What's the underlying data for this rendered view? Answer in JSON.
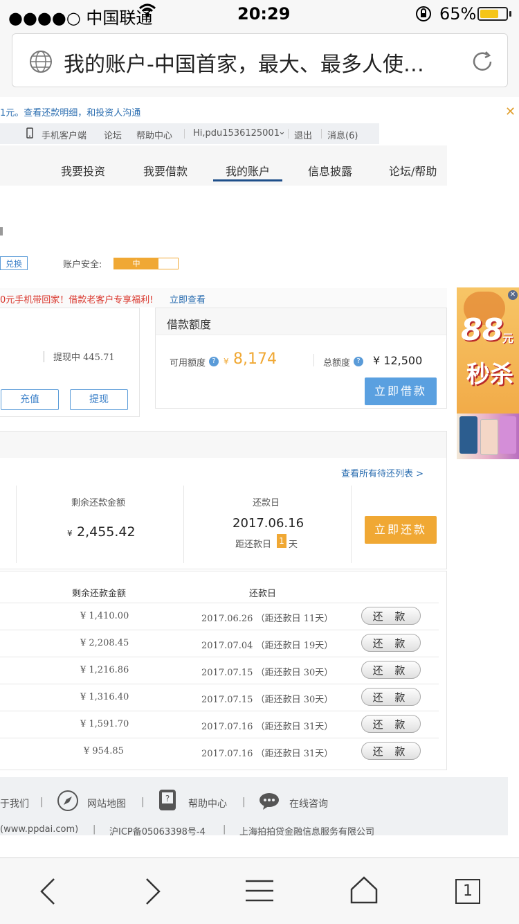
{
  "status_bar": {
    "carrier": "●●●●○ 中国联通",
    "time": "20:29",
    "battery": "65%"
  },
  "browser": {
    "url_title": "我的账户-中国首家，最大、最多人使…"
  },
  "tip": {
    "prefix": "1元。",
    "link": "查看还款明细，和投资人沟通"
  },
  "top_nav": {
    "mobile": "手机客户端",
    "forum": "论坛",
    "help": "帮助中心",
    "user": "Hi,pdu1536125001",
    "logout": "退出",
    "messages": "消息(6)"
  },
  "main_nav": {
    "invest": "我要投资",
    "borrow": "我要借款",
    "account": "我的账户",
    "disclosure": "信息披露",
    "forum_help": "论坛/帮助"
  },
  "account": {
    "exchange_label": "兑换",
    "security_label": "账户安全:",
    "security_level": "中"
  },
  "promo": {
    "text": "0元手机带回家！借款老客户专享福利!",
    "link": "立即查看"
  },
  "balance_card": {
    "withdrawing": "提现中 445.71",
    "recharge": "充值",
    "withdraw": "提现"
  },
  "credit_card": {
    "title": "借款额度",
    "available_label": "可用额度",
    "currency": "¥",
    "available_value": "8,174",
    "total_label": "总额度",
    "total_value": "¥ 12,500",
    "borrow_button": "立即借款"
  },
  "repay_card": {
    "view_all": "查看所有待还列表 >",
    "remaining_label": "剩余还款金额",
    "remaining_value": "2,455.42",
    "currency": "¥",
    "date_label": "还款日",
    "date_value": "2017.06.16",
    "countdown_prefix": "距还款日",
    "countdown_days": "1",
    "countdown_suffix": "天",
    "repay_button": "立即还款"
  },
  "table": {
    "headers": [
      "剩余还款金额",
      "还款日"
    ],
    "rows": [
      {
        "amount": "¥ 1,410.00",
        "date": "2017.06.26 （距还款日 11天）",
        "action": "还 款"
      },
      {
        "amount": "¥ 2,208.45",
        "date": "2017.07.04 （距还款日 19天）",
        "action": "还 款"
      },
      {
        "amount": "¥ 1,216.86",
        "date": "2017.07.15 （距还款日 30天）",
        "action": "还 款"
      },
      {
        "amount": "¥ 1,316.40",
        "date": "2017.07.15 （距还款日 30天）",
        "action": "还 款"
      },
      {
        "amount": "¥ 1,591.70",
        "date": "2017.07.16 （距还款日 31天）",
        "action": "还 款"
      },
      {
        "amount": "¥ 954.85",
        "date": "2017.07.16 （距还款日 31天）",
        "action": "还 款"
      }
    ]
  },
  "footer": {
    "about": "于我们",
    "sitemap": "网站地图",
    "help": "帮助中心",
    "chat": "在线咨询",
    "domain": "(www.ppdai.com)",
    "icp": "沪ICP备05063398号-4",
    "company": "上海拍拍贷金融信息服务有限公司"
  },
  "ad": {
    "big": "88",
    "unit": "元",
    "sale": "秒杀"
  },
  "bottom_bar": {
    "tabs_count": "1"
  }
}
